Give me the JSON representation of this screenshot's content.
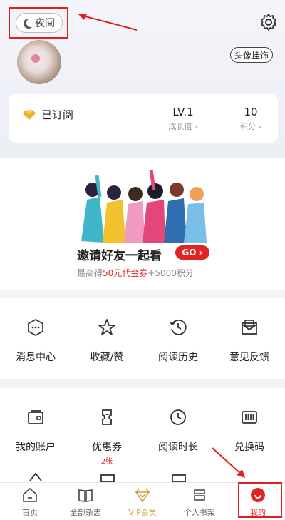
{
  "header": {
    "night_mode_label": "夜间",
    "avatar_frame_label": "头像挂饰"
  },
  "stats": {
    "subscribed_label": "已订阅",
    "level_value": "LV.1",
    "level_caption": "成长值",
    "points_value": "10",
    "points_caption": "积分"
  },
  "invite": {
    "title": "邀请好友一起看",
    "go_label": "GO",
    "subtitle_prefix": "最高得",
    "subtitle_highlight": "50元代金券",
    "subtitle_suffix": "+5000积分"
  },
  "grid1": {
    "items": [
      {
        "label": "消息中心",
        "icon": "message-center-icon"
      },
      {
        "label": "收藏/赞",
        "icon": "star-icon"
      },
      {
        "label": "阅读历史",
        "icon": "history-icon"
      },
      {
        "label": "意见反馈",
        "icon": "feedback-icon"
      }
    ]
  },
  "grid2": {
    "items": [
      {
        "label": "我的账户",
        "icon": "wallet-icon",
        "badge": ""
      },
      {
        "label": "优惠券",
        "icon": "coupon-icon",
        "badge": "2张"
      },
      {
        "label": "阅读时长",
        "icon": "clock-icon",
        "badge": ""
      },
      {
        "label": "兑换码",
        "icon": "barcode-icon",
        "badge": ""
      }
    ]
  },
  "tabbar": {
    "items": [
      {
        "label": "首页",
        "icon": "home-icon"
      },
      {
        "label": "全部杂志",
        "icon": "book-icon"
      },
      {
        "label": "VIP会员",
        "icon": "vip-icon"
      },
      {
        "label": "个人书架",
        "icon": "bookshelf-icon"
      },
      {
        "label": "我的",
        "icon": "profile-icon"
      }
    ],
    "active_color": "#e02424"
  },
  "colors": {
    "accent": "#e02424",
    "annotation": "#e02020",
    "gold": "#d9a520"
  }
}
